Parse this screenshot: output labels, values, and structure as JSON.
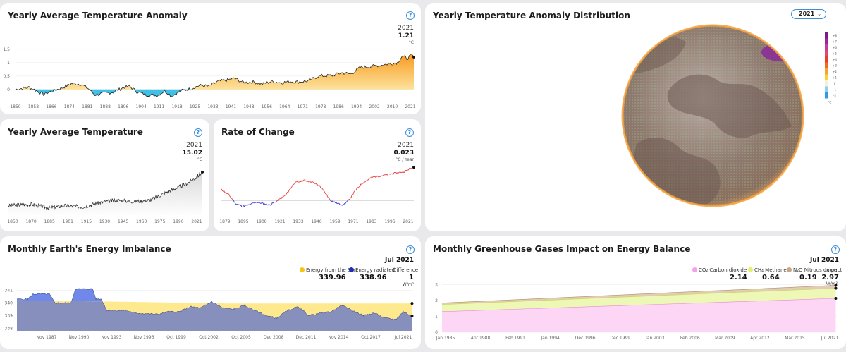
{
  "palette": {
    "warm": "#f7a935",
    "cool": "#3fc0e6",
    "neg": "#3b3bd6",
    "pos": "#e43a3a",
    "sun": "#ffe98f",
    "rad": "#8790bd",
    "rad_high": "#7088ea",
    "co2": "#fcd6f4",
    "ch4": "#edf7b6",
    "n2o": "#e2cdb2"
  },
  "icons": {
    "help": "question-circle-icon",
    "chevron": "chevron-down-icon",
    "marker": "data-point-marker"
  },
  "anomaly": {
    "title": "Yearly Average Temperature Anomaly",
    "help": "?",
    "year": "2021",
    "value": "1.21",
    "unit": "°C",
    "chart_data": {
      "type": "area",
      "x_range": [
        1850,
        2021
      ],
      "ylim": [
        -0.4,
        1.6
      ],
      "yticks": [
        0,
        0.5,
        1,
        1.5
      ],
      "ytick_labels": [
        "0",
        "0.5",
        "1",
        "1.5"
      ],
      "xtick_labels": [
        "1850",
        "1858",
        "1866",
        "1874",
        "1881",
        "1888",
        "1896",
        "1904",
        "1911",
        "1918",
        "1925",
        "1933",
        "1941",
        "1948",
        "1956",
        "1964",
        "1971",
        "1978",
        "1986",
        "1994",
        "2002",
        "2010",
        "2021"
      ],
      "knots": [
        [
          1850,
          0.0
        ],
        [
          1856,
          0.08
        ],
        [
          1862,
          -0.18
        ],
        [
          1866,
          -0.05
        ],
        [
          1870,
          0.06
        ],
        [
          1874,
          0.22
        ],
        [
          1878,
          0.2
        ],
        [
          1881,
          0.05
        ],
        [
          1884,
          -0.2
        ],
        [
          1888,
          -0.15
        ],
        [
          1892,
          -0.1
        ],
        [
          1896,
          0.06
        ],
        [
          1899,
          0.12
        ],
        [
          1902,
          -0.08
        ],
        [
          1906,
          -0.2
        ],
        [
          1911,
          -0.22
        ],
        [
          1914,
          -0.05
        ],
        [
          1917,
          -0.25
        ],
        [
          1921,
          -0.05
        ],
        [
          1925,
          0.02
        ],
        [
          1929,
          0.15
        ],
        [
          1933,
          0.12
        ],
        [
          1937,
          0.3
        ],
        [
          1941,
          0.35
        ],
        [
          1944,
          0.42
        ],
        [
          1948,
          0.25
        ],
        [
          1952,
          0.28
        ],
        [
          1956,
          0.2
        ],
        [
          1960,
          0.3
        ],
        [
          1964,
          0.25
        ],
        [
          1968,
          0.3
        ],
        [
          1971,
          0.28
        ],
        [
          1976,
          0.32
        ],
        [
          1980,
          0.5
        ],
        [
          1986,
          0.52
        ],
        [
          1990,
          0.62
        ],
        [
          1994,
          0.58
        ],
        [
          1998,
          0.82
        ],
        [
          2002,
          0.85
        ],
        [
          2006,
          0.9
        ],
        [
          2010,
          0.95
        ],
        [
          2014,
          1.0
        ],
        [
          2016,
          1.25
        ],
        [
          2018,
          1.15
        ],
        [
          2020,
          1.28
        ],
        [
          2021,
          1.21
        ]
      ]
    }
  },
  "yearly_temp": {
    "title": "Yearly Average Temperature",
    "help": "?",
    "year": "2021",
    "value": "15.02",
    "unit": "°C",
    "chart_data": {
      "type": "area",
      "x_range": [
        1850,
        2021
      ],
      "ylim": [
        13.4,
        15.4
      ],
      "baseline": 14.0,
      "xtick_labels": [
        "1850",
        "1870",
        "1885",
        "1901",
        "1915",
        "1930",
        "1945",
        "1960",
        "1975",
        "1990",
        "2021"
      ],
      "knots": [
        [
          1850,
          13.8
        ],
        [
          1870,
          13.85
        ],
        [
          1885,
          13.72
        ],
        [
          1901,
          13.8
        ],
        [
          1915,
          13.75
        ],
        [
          1930,
          13.9
        ],
        [
          1945,
          14.0
        ],
        [
          1960,
          13.95
        ],
        [
          1975,
          14.0
        ],
        [
          1990,
          14.3
        ],
        [
          2005,
          14.55
        ],
        [
          2015,
          14.8
        ],
        [
          2021,
          15.02
        ]
      ]
    }
  },
  "rate": {
    "title": "Rate of Change",
    "help": "?",
    "year": "2021",
    "value": "0.023",
    "unit": "°C / Year",
    "chart_data": {
      "type": "line",
      "x_range": [
        1879,
        2021
      ],
      "ylim": [
        -0.012,
        0.026
      ],
      "xtick_labels": [
        "1879",
        "1895",
        "1908",
        "1921",
        "1933",
        "1946",
        "1959",
        "1971",
        "1983",
        "1996",
        "2021"
      ],
      "knots": [
        [
          1879,
          0.008
        ],
        [
          1885,
          0.004
        ],
        [
          1890,
          -0.002
        ],
        [
          1895,
          -0.004
        ],
        [
          1900,
          -0.003
        ],
        [
          1905,
          -0.001
        ],
        [
          1910,
          -0.002
        ],
        [
          1915,
          -0.003
        ],
        [
          1921,
          0.0
        ],
        [
          1927,
          0.004
        ],
        [
          1933,
          0.012
        ],
        [
          1940,
          0.014
        ],
        [
          1946,
          0.013
        ],
        [
          1952,
          0.01
        ],
        [
          1956,
          0.005
        ],
        [
          1960,
          0.0
        ],
        [
          1965,
          -0.002
        ],
        [
          1969,
          -0.003
        ],
        [
          1973,
          0.0
        ],
        [
          1978,
          0.007
        ],
        [
          1983,
          0.012
        ],
        [
          1990,
          0.016
        ],
        [
          1996,
          0.017
        ],
        [
          2002,
          0.018
        ],
        [
          2008,
          0.019
        ],
        [
          2014,
          0.02
        ],
        [
          2018,
          0.022
        ],
        [
          2021,
          0.023
        ]
      ]
    }
  },
  "distribution": {
    "title": "Yearly Temperature Anomaly Distribution",
    "help": "?",
    "selected_year": "2021",
    "scale_labels": [
      "+8",
      "+7",
      "+6",
      "+5",
      "+4",
      "+3",
      "+2",
      "+1",
      "0",
      "-1",
      "-2"
    ],
    "scale_unit": "°C"
  },
  "imbalance": {
    "title": "Monthly Earth's Energy Imbalance",
    "help": "?",
    "date": "Jul 2021",
    "legend": [
      {
        "label": "Energy from the Sun",
        "value": "339.96",
        "color": "#f5c518"
      },
      {
        "label": "Energy radiated",
        "value": "338.96",
        "color": "#1c2db8"
      }
    ],
    "difference_label": "Difference",
    "difference_value": "1",
    "unit": "W/m²",
    "chart_data": {
      "type": "area",
      "x_range": [
        1985.0,
        2021.6
      ],
      "ylim": [
        337.8,
        341.8
      ],
      "yticks": [
        338,
        339,
        340,
        341
      ],
      "ytick_labels": [
        "338",
        "339",
        "340",
        "341"
      ],
      "xtick_labels": [
        "Nov 1987",
        "Nov 1990",
        "Nov 1993",
        "Nov 1996",
        "Oct 1999",
        "Oct 2002",
        "Oct 2005",
        "Dec 2008",
        "Dec 2011",
        "Nov 2014",
        "Oct 2017",
        "Jul 2021"
      ],
      "sun": [
        [
          1985,
          340.2
        ],
        [
          1994,
          340.1
        ],
        [
          2005,
          339.95
        ],
        [
          2015,
          339.95
        ],
        [
          2021.5,
          339.96
        ]
      ],
      "radiated": [
        [
          1985,
          340.3
        ],
        [
          1986,
          340.3
        ],
        [
          1986.5,
          340.7
        ],
        [
          1988,
          340.7
        ],
        [
          1988.5,
          340.0
        ],
        [
          1990,
          340.0
        ],
        [
          1990.4,
          341.1
        ],
        [
          1992,
          341.1
        ],
        [
          1992.3,
          340.3
        ],
        [
          1992.8,
          340.3
        ],
        [
          1993.3,
          339.4
        ],
        [
          1995,
          339.4
        ],
        [
          1996,
          339.2
        ],
        [
          1998,
          339.1
        ],
        [
          1999,
          339.3
        ],
        [
          2000,
          339.3
        ],
        [
          2001,
          339.7
        ],
        [
          2002,
          339.6
        ],
        [
          2003,
          340.1
        ],
        [
          2004,
          339.6
        ],
        [
          2005,
          339.5
        ],
        [
          2006,
          339.8
        ],
        [
          2007,
          339.4
        ],
        [
          2008,
          339.0
        ],
        [
          2009,
          338.8
        ],
        [
          2010,
          339.4
        ],
        [
          2011,
          339.7
        ],
        [
          2012,
          339.0
        ],
        [
          2013,
          339.2
        ],
        [
          2014,
          339.3
        ],
        [
          2015,
          339.8
        ],
        [
          2016,
          339.4
        ],
        [
          2017,
          339.0
        ],
        [
          2018,
          339.2
        ],
        [
          2019,
          338.8
        ],
        [
          2020,
          338.7
        ],
        [
          2020.7,
          339.3
        ],
        [
          2021.5,
          338.96
        ]
      ]
    }
  },
  "greenhouse": {
    "title": "Monthly Greenhouse Gases Impact on Energy Balance",
    "help": "?",
    "date": "Jul 2021",
    "legend": [
      {
        "label": "CO₂ Carbon dioxide",
        "value": "2.14",
        "color": "#f4a3e8"
      },
      {
        "label": "CH₄ Methane",
        "value": "0.64",
        "color": "#e3f16a"
      },
      {
        "label": "N₂O Nitrous oxide",
        "value": "0.19",
        "color": "#c8a882"
      }
    ],
    "impact_label": "Impact",
    "impact_value": "2.97",
    "unit": "W/m²",
    "chart_data": {
      "type": "area",
      "x_range": [
        1985.0,
        2021.6
      ],
      "ylim": [
        0,
        3.3
      ],
      "yticks": [
        0,
        1,
        2,
        3
      ],
      "ytick_labels": [
        "0",
        "1",
        "2",
        "3"
      ],
      "xtick_labels": [
        "Jan 1985",
        "Apr 1988",
        "Feb 1991",
        "Jan 1994",
        "Dec 1996",
        "Dec 1999",
        "Jan 2003",
        "Feb 2006",
        "Mar 2009",
        "Apr 2012",
        "Mar 2015",
        "Jul 2021"
      ],
      "co2": [
        [
          1985,
          1.3
        ],
        [
          2021.5,
          2.14
        ]
      ],
      "ch4": [
        [
          1985,
          0.45
        ],
        [
          2021.5,
          0.64
        ]
      ],
      "n2o": [
        [
          1985,
          0.1
        ],
        [
          2021.5,
          0.19
        ]
      ]
    }
  }
}
